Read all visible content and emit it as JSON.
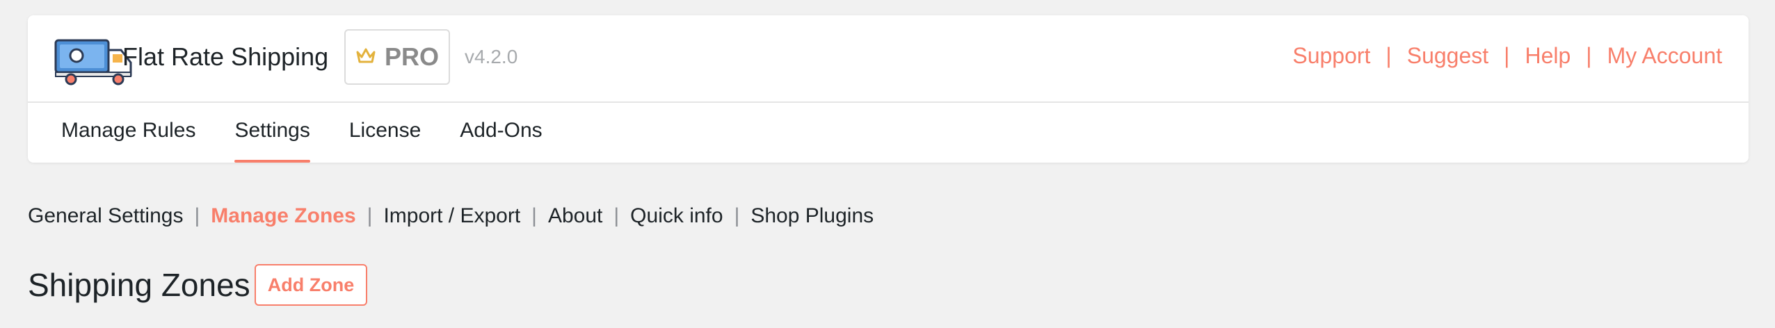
{
  "header": {
    "logo_icon": "truck-icon",
    "plugin_name": "Flat Rate Shipping",
    "badge": {
      "icon": "crown-icon",
      "label": "PRO"
    },
    "version": "v4.2.0",
    "links": [
      "Support",
      "Suggest",
      "Help",
      "My Account"
    ],
    "link_separator": "|"
  },
  "tabs": [
    {
      "label": "Manage Rules",
      "active": false
    },
    {
      "label": "Settings",
      "active": true
    },
    {
      "label": "License",
      "active": false
    },
    {
      "label": "Add-Ons",
      "active": false
    }
  ],
  "subnav": {
    "items": [
      {
        "label": "General Settings",
        "active": false
      },
      {
        "label": "Manage Zones",
        "active": true
      },
      {
        "label": "Import / Export",
        "active": false
      },
      {
        "label": "About",
        "active": false
      },
      {
        "label": "Quick info",
        "active": false
      },
      {
        "label": "Shop Plugins",
        "active": false
      }
    ],
    "separator": "|"
  },
  "main": {
    "title": "Shipping Zones",
    "add_button_label": "Add Zone"
  },
  "colors": {
    "accent": "#f87f6b",
    "background": "#f1f1f1",
    "text": "#1d2327",
    "muted": "#a7aaad",
    "crown": "#e3b23c"
  }
}
